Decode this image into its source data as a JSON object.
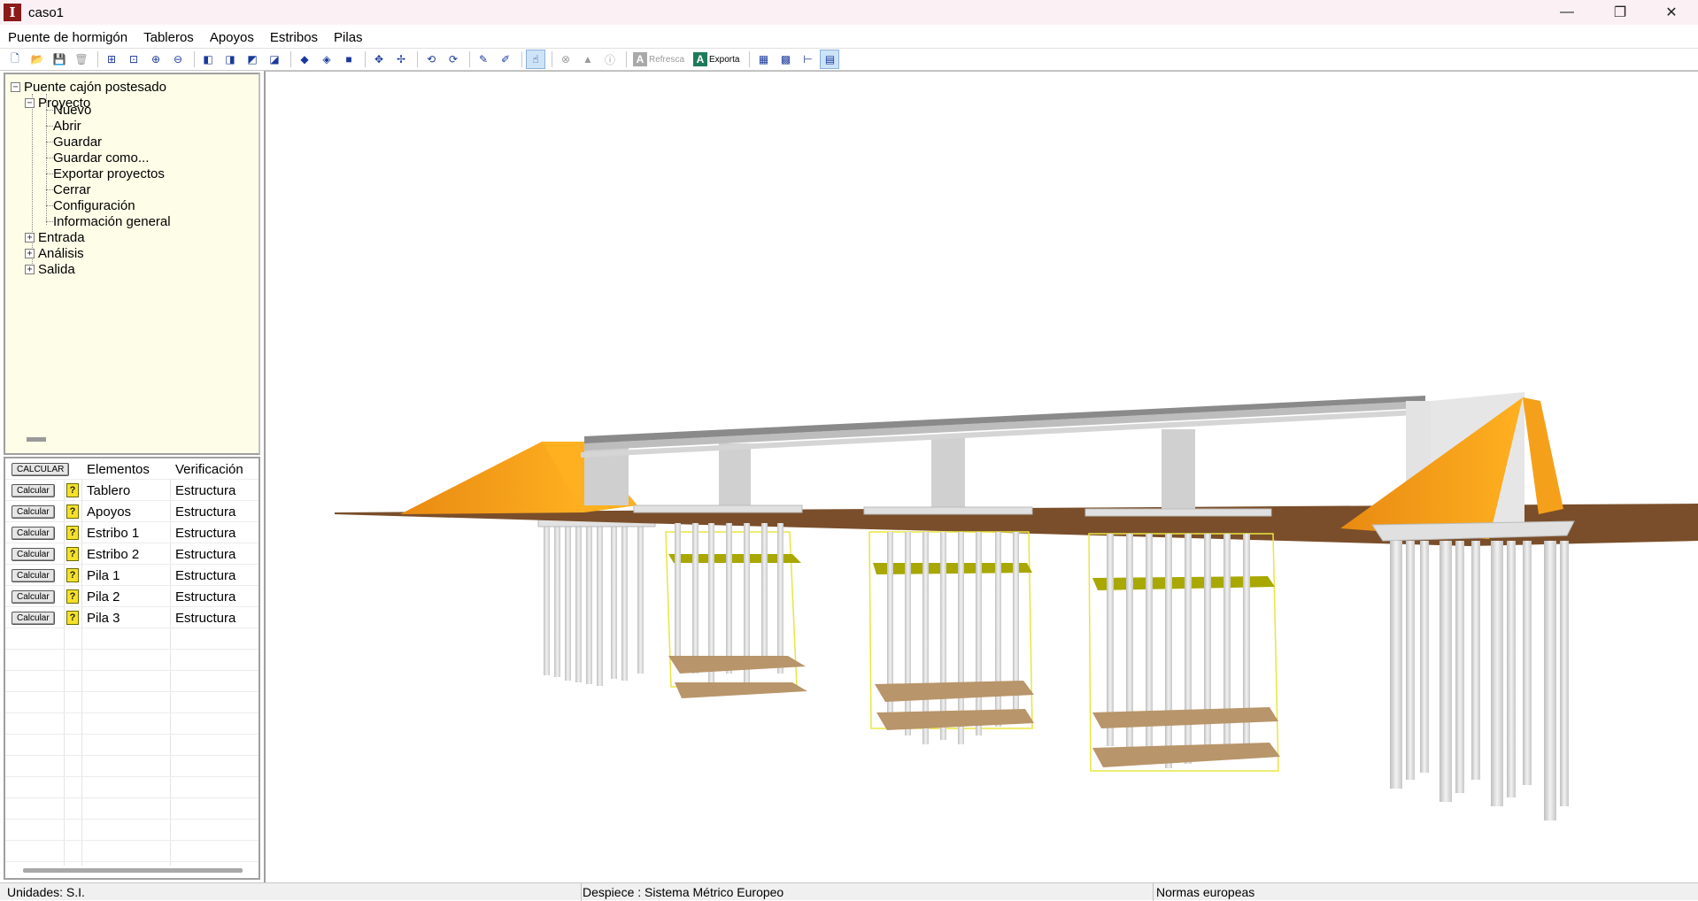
{
  "window": {
    "title": "caso1",
    "icon": "app-logo-icon",
    "controls": [
      "minimize-icon",
      "restore-icon",
      "close-icon"
    ]
  },
  "menu": [
    "Puente de hormigón",
    "Tableros",
    "Apoyos",
    "Estribos",
    "Pilas"
  ],
  "toolbar": {
    "refresca_label": "Refresca",
    "exporta_label": "Exporta"
  },
  "tree": {
    "root": "Puente cajón postesado",
    "proyecto": "Proyecto",
    "proyecto_items": [
      "Nuevo",
      "Abrir",
      "Guardar",
      "Guardar como...",
      "Exportar proyectos",
      "Cerrar",
      "Configuración",
      "Información general"
    ],
    "others": [
      "Entrada",
      "Análisis",
      "Salida"
    ]
  },
  "grid": {
    "calcular_all": "CALCULAR",
    "headers": {
      "elementos": "Elementos",
      "verificacion": "Verificación"
    },
    "row_button": "Calcular",
    "status_icon": "?",
    "rows": [
      {
        "elemento": "Tablero",
        "verificacion": "Estructura"
      },
      {
        "elemento": "Apoyos",
        "verificacion": "Estructura"
      },
      {
        "elemento": "Estribo 1",
        "verificacion": "Estructura"
      },
      {
        "elemento": "Estribo 2",
        "verificacion": "Estructura"
      },
      {
        "elemento": "Pila 1",
        "verificacion": "Estructura"
      },
      {
        "elemento": "Pila 2",
        "verificacion": "Estructura"
      },
      {
        "elemento": "Pila 3",
        "verificacion": "Estructura"
      }
    ]
  },
  "status": {
    "unidades": "Unidades: S.I.",
    "despiece": "Despiece :  Sistema Métrico Europeo",
    "normas": "Normas europeas"
  },
  "colors": {
    "abutment": "#f5a01a",
    "ground": "#7a4e2a",
    "concrete": "#d6d6d6",
    "footing": "#b8956a",
    "pile_level": "#a8a800",
    "cage_outline": "#e8e640"
  }
}
